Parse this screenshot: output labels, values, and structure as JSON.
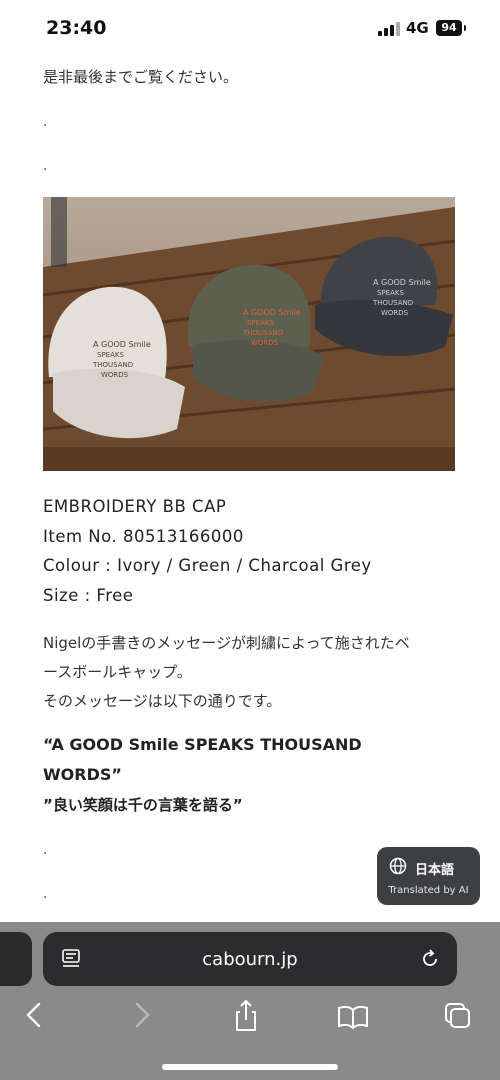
{
  "status_bar": {
    "time": "23:40",
    "network": "4G",
    "battery": "94"
  },
  "content": {
    "intro": "是非最後までご覧ください。",
    "separator_1": ".",
    "separator_2": ".",
    "product_name": "EMBROIDERY BB CAP",
    "item_no": "Item No. 80513166000",
    "colour": "Colour : Ivory / Green / Charcoal Grey",
    "size": "Size : Free",
    "description_line1": "Nigelの手書きのメッセージが刺繍によって施されたベ",
    "description_line2": "ースボールキャップ。",
    "description_line3": "そのメッセージは以下の通りです。",
    "quote_en_line1": "“A GOOD Smile SPEAKS THOUSAND",
    "quote_en_line2": "WORDS”",
    "quote_jp": "”良い笑顔は千の言葉を語る”",
    "separator_3": ".",
    "separator_4": "."
  },
  "cap_embroidery": {
    "line1": "A GOOD Smile",
    "line2": "SPEAKS",
    "line3": "THOUSAND",
    "line4": "WORDS"
  },
  "translate_badge": {
    "language": "日本語",
    "caption": "Translated by AI"
  },
  "browser": {
    "url": "cabourn.jp"
  },
  "colors": {
    "ivory_cap": "#e4e0d9",
    "green_cap": "#5d5f4f",
    "charcoal_cap": "#3f4246",
    "wood": "#7a5234"
  }
}
